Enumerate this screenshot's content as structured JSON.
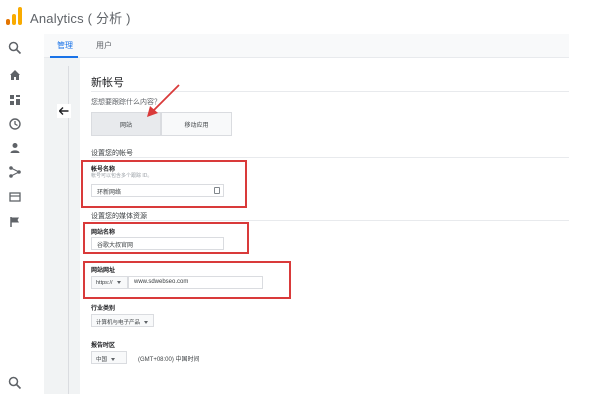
{
  "header": {
    "app_title": "Analytics ( 分析 )"
  },
  "tabs": [
    {
      "label": "管理"
    },
    {
      "label": "用户"
    }
  ],
  "rail_icons": [
    "search-icon",
    "home-icon",
    "dashboard-icon",
    "clock-icon",
    "person-icon",
    "share-icon",
    "report-icon",
    "flag-icon",
    "search-icon"
  ],
  "form": {
    "title": "新帐号",
    "question": "您想要跟踪什么内容？",
    "choices": {
      "website": "网站",
      "mobile": "移动应用"
    },
    "account_section": "设置您的帐号",
    "account_name_label": "帐号名称",
    "account_name_hint": "帐号可以包含多个跟踪 ID。",
    "account_name_value": "环新网络",
    "property_section": "设置您的媒体资源",
    "website_name_label": "网站名称",
    "website_name_value": "谷歌大叔官网",
    "website_url_label": "网站网址",
    "protocol_value": "https://",
    "website_url_value": "www.sdwebseo.com",
    "industry_label": "行业类别",
    "industry_value": "计算机与电子产品",
    "timezone_label": "报告时区",
    "timezone_country": "中国",
    "timezone_value": "(GMT+08:00) 中国时间"
  },
  "colors": {
    "accent": "#1a73e8",
    "highlight_border": "#d93a3a",
    "logo_orange": "#f9ab00",
    "logo_dark_orange": "#e37400"
  }
}
